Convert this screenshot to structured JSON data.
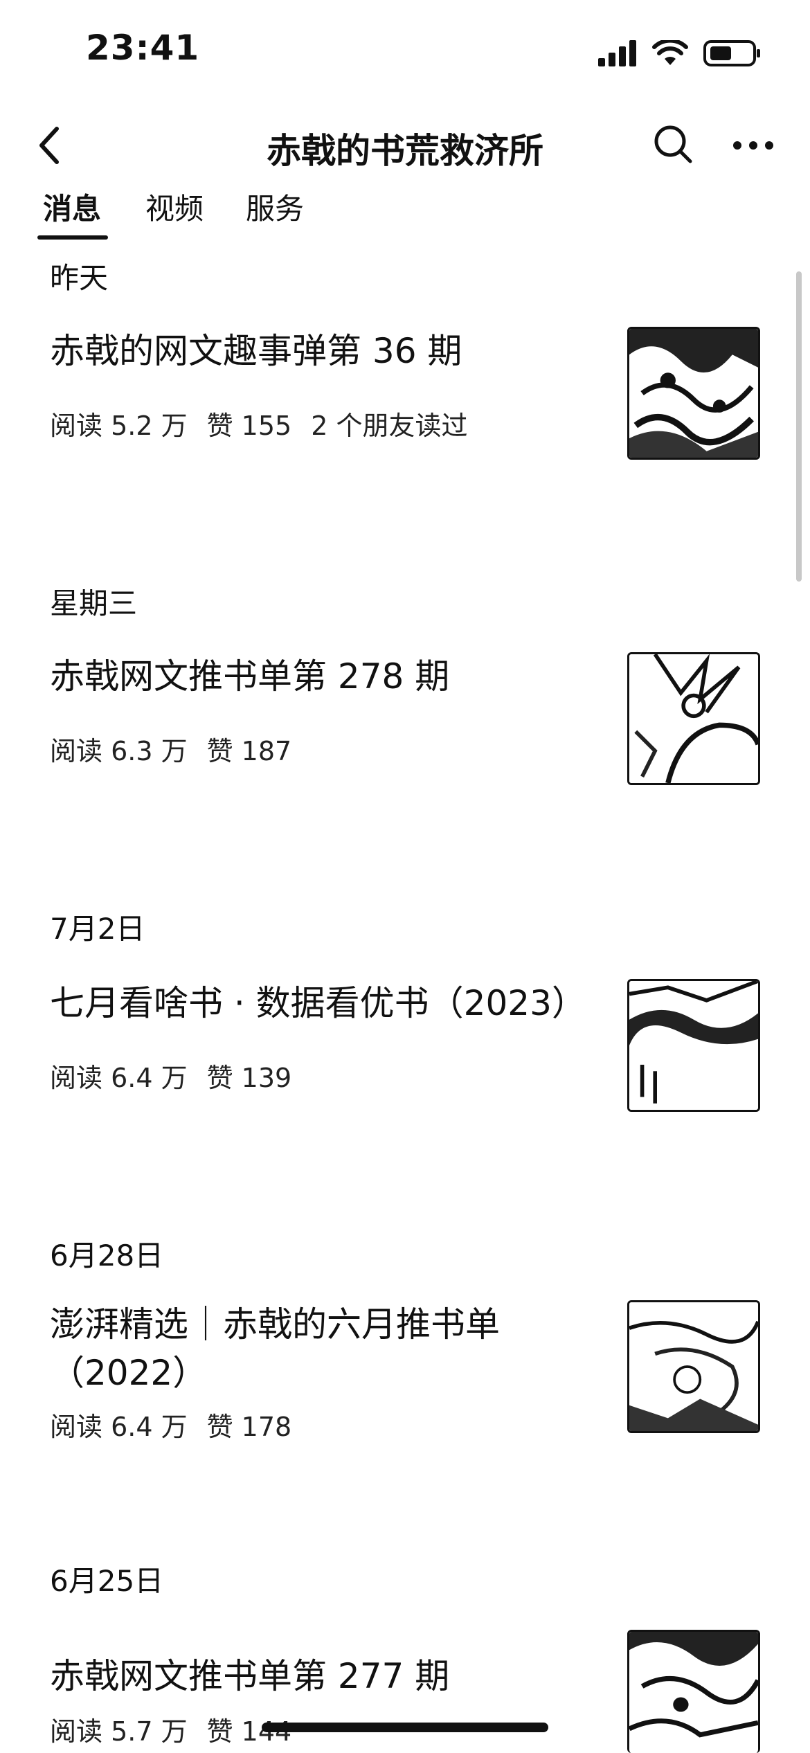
{
  "status_bar": {
    "time": "23:41",
    "icons": [
      "signal-icon",
      "wifi-icon",
      "battery-icon"
    ]
  },
  "nav": {
    "title": "赤戟的书荒救济所",
    "icons": [
      "back-icon",
      "search-icon",
      "more-icon"
    ]
  },
  "tabs": [
    {
      "label": "消息",
      "active": true
    },
    {
      "label": "视频",
      "active": false
    },
    {
      "label": "服务",
      "active": false
    }
  ],
  "feed": [
    {
      "date": "昨天",
      "title": "赤戟的网文趣事弹第 36 期",
      "meta": [
        "阅读 5.2 万",
        "赞 155",
        "2 个朋友读过"
      ]
    },
    {
      "date": "星期三",
      "title": "赤戟网文推书单第 278 期",
      "meta": [
        "阅读 6.3 万",
        "赞 187"
      ]
    },
    {
      "date": "7月2日",
      "title": "七月看啥书 · 数据看优书（2023）",
      "meta": [
        "阅读 6.4 万",
        "赞 139"
      ]
    },
    {
      "date": "6月28日",
      "title": "澎湃精选｜赤戟的六月推书单（2022）",
      "meta": [
        "阅读 6.4 万",
        "赞 178"
      ]
    },
    {
      "date": "6月25日",
      "title": "赤戟网文推书单第 277 期",
      "meta": [
        "阅读 5.7 万",
        "赞 144"
      ]
    }
  ]
}
